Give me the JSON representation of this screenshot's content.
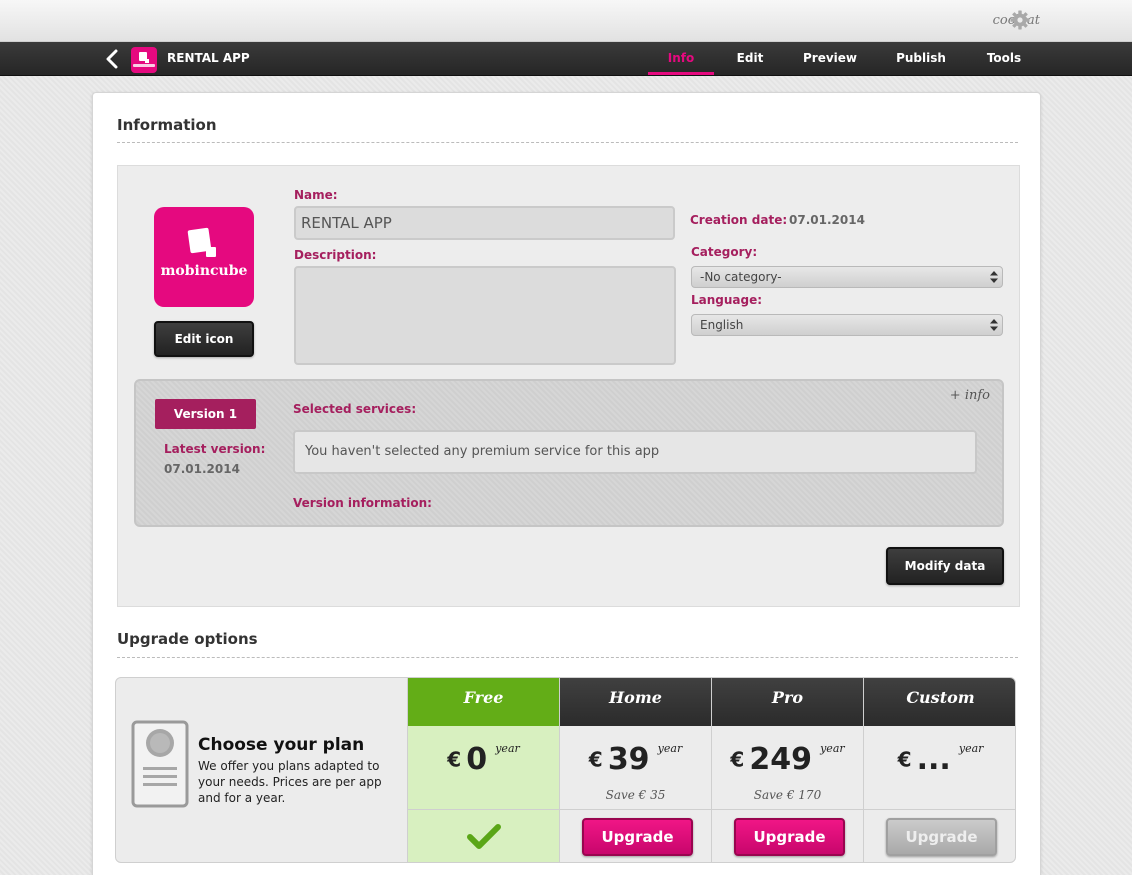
{
  "user": {
    "name": "coolcat"
  },
  "nav": {
    "app_title": "RENTAL APP",
    "tabs": [
      {
        "label": "Info",
        "active": true
      },
      {
        "label": "Edit",
        "active": false
      },
      {
        "label": "Preview",
        "active": false
      },
      {
        "label": "Publish",
        "active": false
      },
      {
        "label": "Tools",
        "active": false
      }
    ]
  },
  "information": {
    "title": "Information",
    "icon_brand": "mobincube",
    "edit_icon_label": "Edit icon",
    "name_label": "Name:",
    "name_value": "RENTAL APP",
    "description_label": "Description:",
    "description_value": "",
    "creation_date_label": "Creation date:",
    "creation_date_value": "07.01.2014",
    "category_label": "Category:",
    "category_value": "-No category-",
    "language_label": "Language:",
    "language_value": "English",
    "version": {
      "badge": "Version 1",
      "latest_label": "Latest version:",
      "latest_value": "07.01.2014",
      "plus_info": "+ info",
      "services_label": "Selected services:",
      "services_value": "You haven't selected any premium service for this app",
      "version_info_label": "Version information:"
    },
    "modify_label": "Modify data"
  },
  "upgrade": {
    "title": "Upgrade options",
    "heading": "Choose your plan",
    "description": "We offer you plans adapted to your needs. Prices are per app and for a year.",
    "plans": [
      {
        "name": "Free",
        "currency": "€",
        "price": "0",
        "period": "year",
        "save": "",
        "action": "check"
      },
      {
        "name": "Home",
        "currency": "€",
        "price": "39",
        "period": "year",
        "save": "Save € 35",
        "action": "Upgrade"
      },
      {
        "name": "Pro",
        "currency": "€",
        "price": "249",
        "period": "year",
        "save": "Save € 170",
        "action": "Upgrade"
      },
      {
        "name": "Custom",
        "currency": "€",
        "price": "...",
        "period": "year",
        "save": "",
        "action": "Upgrade"
      }
    ]
  },
  "colors": {
    "accent": "#e5097f",
    "label": "#a51f5e",
    "free_green": "#63ad17",
    "free_bg": "#d8f0c0"
  },
  "icons": [
    "settings-gear-icon",
    "back-chevron-icon",
    "mobincube-logo",
    "certificate-document-icon",
    "checkmark-icon",
    "select-arrows-icon"
  ]
}
